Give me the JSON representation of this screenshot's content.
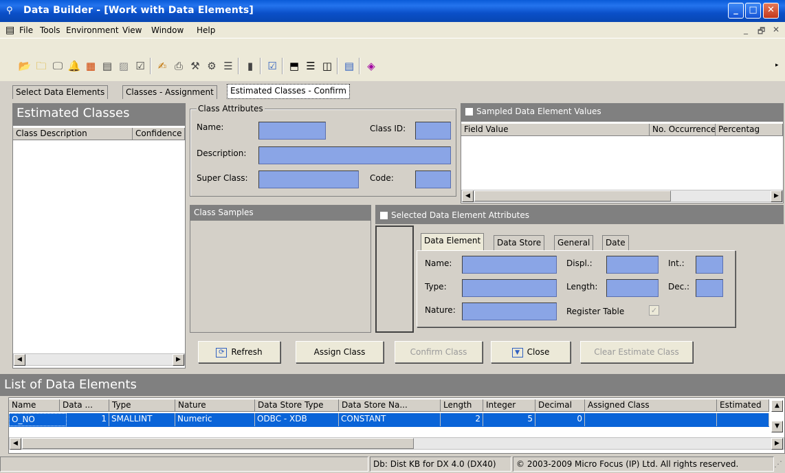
{
  "window": {
    "title": "Data Builder - [Work with Data Elements]"
  },
  "menu": [
    "File",
    "Tools",
    "Environment",
    "View",
    "Window",
    "Help"
  ],
  "tabs": [
    "Select Data Elements",
    "Classes - Assignment",
    "Estimated Classes - Confirm"
  ],
  "estimated_classes": {
    "title": "Estimated Classes",
    "columns": [
      "Class Description",
      "Confidence"
    ]
  },
  "class_attributes": {
    "group_label": "Class Attributes",
    "name_label": "Name:",
    "class_id_label": "Class ID:",
    "description_label": "Description:",
    "super_class_label": "Super Class:",
    "code_label": "Code:"
  },
  "sampled_values": {
    "title": "Sampled Data Element Values",
    "columns": [
      "Field Value",
      "No. Occurrences",
      "Percentag"
    ]
  },
  "class_samples": {
    "title": "Class Samples"
  },
  "selected_attributes": {
    "title": "Selected Data Element Attributes",
    "tabs": [
      "Data Element",
      "Data Store",
      "General",
      "Date"
    ],
    "name_label": "Name:",
    "type_label": "Type:",
    "nature_label": "Nature:",
    "displ_label": "Displ.:",
    "length_label": "Length:",
    "register_label": "Register Table",
    "int_label": "Int.:",
    "dec_label": "Dec.:"
  },
  "buttons": {
    "refresh": "Refresh",
    "assign": "Assign Class",
    "confirm": "Confirm Class",
    "close": "Close",
    "clear": "Clear Estimate Class"
  },
  "data_elements": {
    "title": "List of Data Elements",
    "columns": [
      "Name",
      "Data ...",
      "Type",
      "Nature",
      "Data Store Type",
      "Data Store Na...",
      "Length",
      "Integer",
      "Decimal",
      "Assigned Class",
      "Estimated"
    ],
    "rows": [
      {
        "name": "O_NO",
        "data": "1",
        "type": "SMALLINT",
        "nature": "Numeric",
        "store_type": "ODBC - XDB",
        "store_name": "CONSTANT",
        "length": "2",
        "integer": "5",
        "decimal": "0",
        "assigned": "",
        "estimated": ""
      }
    ]
  },
  "status": {
    "db": "Db: Dist KB for DX 4.0 (DX40)",
    "copyright": "© 2003-2009 Micro Focus (IP) Ltd. All rights reserved."
  },
  "colors": {
    "title_blue": "#0a4fc8",
    "field_blue": "#8aa5e6",
    "selection_blue": "#0a64d8",
    "panel_gray": "#808080"
  }
}
